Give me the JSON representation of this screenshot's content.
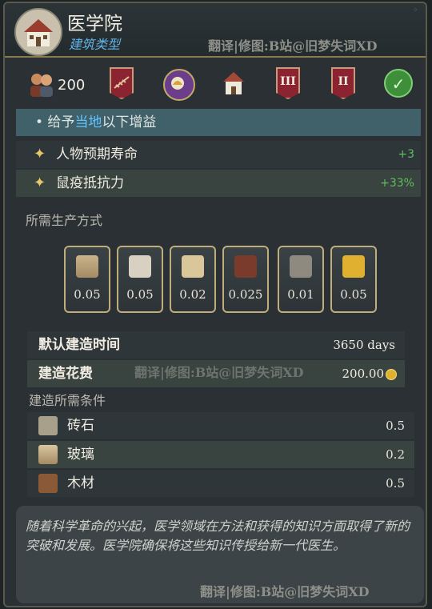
{
  "header": {
    "title": "医学院",
    "subtitle": "建筑类型",
    "watermark": "翻译|修图:B站@旧梦失词XD",
    "icon": "building-house-icon"
  },
  "icon_row": {
    "population": "200",
    "banners": [
      "III",
      "II"
    ],
    "icons": [
      "population-icon",
      "railway-banner-icon",
      "religion-icon",
      "building-icon",
      "tier-three-icon",
      "tier-two-icon",
      "check-icon"
    ]
  },
  "bonus": {
    "header_prefix": "• 给予",
    "header_highlight": "当地",
    "header_suffix": "以下增益",
    "rows": [
      {
        "label": "人物预期寿命",
        "value": "+3"
      },
      {
        "label": "鼠疫抵抗力",
        "value": "+33%"
      }
    ]
  },
  "production": {
    "title": "所需生产方式",
    "goods": [
      {
        "icon": "glass-icon",
        "value": "0.05",
        "color": "#b9a07a"
      },
      {
        "icon": "cloth-icon",
        "value": "0.05",
        "color": "#d8d0c0"
      },
      {
        "icon": "paper-icon",
        "value": "0.02",
        "color": "#d9c79a"
      },
      {
        "icon": "lumber-icon",
        "value": "0.025",
        "color": "#7a3b2c"
      },
      {
        "icon": "tools-icon",
        "value": "0.01",
        "color": "#8e8a80"
      },
      {
        "icon": "gold-icon",
        "value": "0.05",
        "color": "#e0b030"
      }
    ]
  },
  "construction": {
    "time_label": "默认建造时间",
    "time_value": "3650 days",
    "cost_label": "建造花费",
    "cost_value": "200.00",
    "watermark": "翻译|修图:B站@旧梦失词XD"
  },
  "requirements": {
    "title": "建造所需条件",
    "rows": [
      {
        "label": "砖石",
        "value": "0.5",
        "icon": "stone-icon"
      },
      {
        "label": "玻璃",
        "value": "0.2",
        "icon": "glass-icon"
      },
      {
        "label": "木材",
        "value": "0.5",
        "icon": "wood-icon"
      }
    ]
  },
  "description": {
    "text": "随着科学革命的兴起，医学领域在方法和获得的知识方面取得了新的突破和发展。医学院确保将这些知识传授给新一代医生。",
    "watermark": "翻译|修图:B站@旧梦失词XD"
  }
}
